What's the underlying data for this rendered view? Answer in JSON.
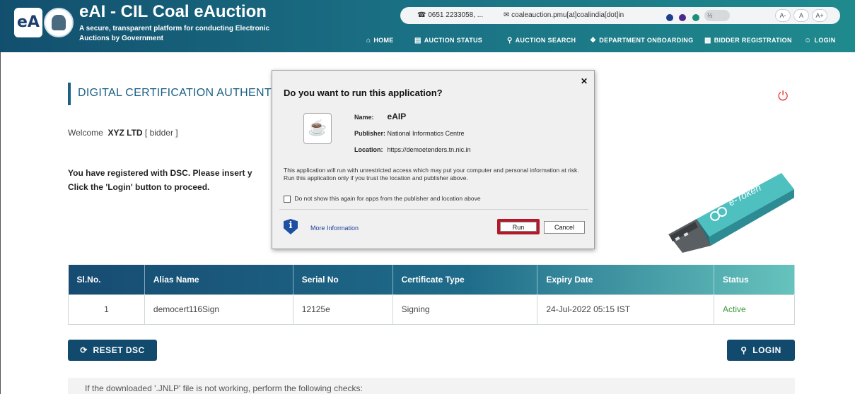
{
  "header": {
    "logo_text": "eA",
    "title": "eAI - CIL Coal eAuction",
    "subtitle": "A secure, transparent platform for conducting Electronic Auctions by Government",
    "phone": "0651 2233058, ...",
    "email": "coaleauction.pmu[at]coalindia[dot]in",
    "font_small": "A-",
    "font_normal": "A",
    "font_large": "A+",
    "contrast_label": "½",
    "theme_colors": [
      "#1d3f8f",
      "#4c2a8c",
      "#1c8f7c"
    ],
    "nav": [
      {
        "label": "HOME",
        "icon": "home-icon"
      },
      {
        "label": "AUCTION STATUS",
        "icon": "list-icon"
      },
      {
        "label": "AUCTION SEARCH",
        "icon": "search-icon"
      },
      {
        "label": "DEPARTMENT ONBOARDING",
        "icon": "leaf-icon"
      },
      {
        "label": "BIDDER REGISTRATION",
        "icon": "id-card-icon"
      },
      {
        "label": "LOGIN",
        "icon": "user-icon"
      }
    ]
  },
  "page": {
    "heading": "DIGITAL CERTIFICATION AUTHENT",
    "welcome_prefix": "Welcome",
    "user_name": "XYZ LTD",
    "role_text": "[ bidder ]",
    "message_line1": "You have registered with DSC. Please insert y",
    "message_line2": "Click the 'Login' button to proceed.",
    "token_label": "e-Token"
  },
  "table": {
    "headers": [
      "Sl.No.",
      "Alias Name",
      "Serial No",
      "Certificate Type",
      "Expiry Date",
      "Status"
    ],
    "rows": [
      [
        "1",
        "democert116Sign",
        "12125e",
        "Signing",
        "24-Jul-2022 05:15 IST",
        "Active"
      ]
    ]
  },
  "buttons": {
    "reset": "RESET DSC",
    "login": "LOGIN"
  },
  "footer_note": "If the downloaded '.JNLP' file is not working, perform the following checks:",
  "dialog": {
    "title": "Do you want to run this application?",
    "name_label": "Name:",
    "name_value": "eAIP",
    "publisher_label": "Publisher:",
    "publisher_value": "National Informatics Centre",
    "location_label": "Location:",
    "location_value": "https://demoetenders.tn.nic.in",
    "warning": "This application will run with unrestricted access which may put your computer and personal information at risk. Run this application only if you trust the location and publisher above.",
    "checkbox_label": "Do not show this again for apps from the publisher and location above",
    "more_info": "More Information",
    "run": "Run",
    "cancel": "Cancel"
  }
}
